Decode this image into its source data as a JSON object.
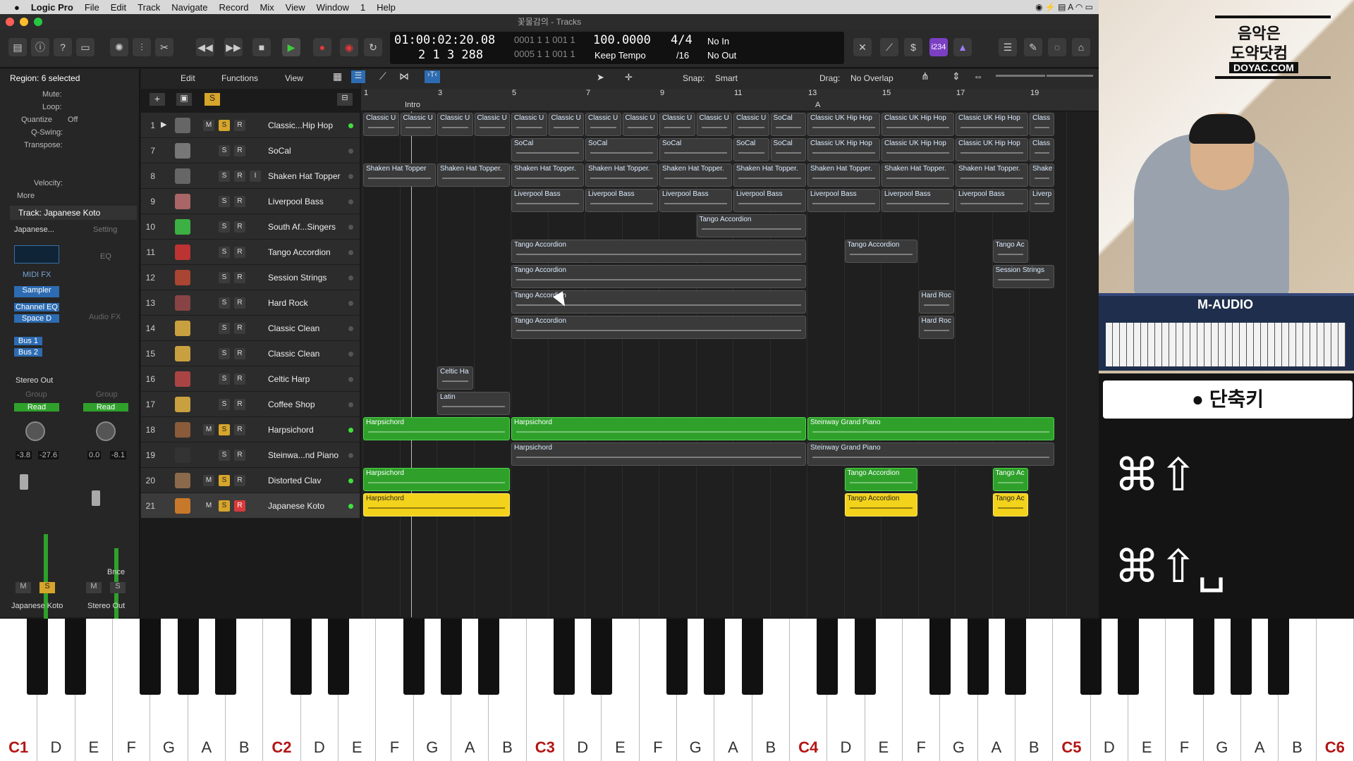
{
  "menu": {
    "app": "Logic Pro",
    "items": [
      "File",
      "Edit",
      "Track",
      "Navigate",
      "Record",
      "Mix",
      "View",
      "Window",
      "1",
      "Help"
    ]
  },
  "window_title": "꽃물감의 - Tracks",
  "lcd": {
    "time": "01:00:02:20.08",
    "bars": "2 1 3 288",
    "pos1": "0001 1 1 001 1",
    "pos2": "0005 1 1 001 1",
    "tempo": "100.0000",
    "tempo_mode": "Keep Tempo",
    "sig": "4/4",
    "div": "/16",
    "in": "No In",
    "out": "No Out",
    "cpu": "i234"
  },
  "inspector": {
    "region_header": "Region: 6 selected",
    "mute": "Mute:",
    "loop": "Loop:",
    "quantize": "Quantize",
    "quant_val": "Off",
    "qswing": "Q-Swing:",
    "transpose": "Transpose:",
    "velocity": "Velocity:",
    "more": "More",
    "track_header": "Track: Japanese Koto",
    "plugin_name": "Japanese...",
    "setting": "Setting",
    "midi_fx": "MIDI FX",
    "eq": "EQ",
    "sampler": "Sampler",
    "channel_eq": "Channel EQ",
    "space_d": "Space D",
    "audio_fx": "Audio FX",
    "bus1": "Bus 1",
    "bus2": "Bus 2",
    "stereo_out": "Stereo Out",
    "group": "Group",
    "read": "Read",
    "vol_a": "-3.8",
    "vol_b": "-27.6",
    "vol_c": "0.0",
    "vol_d": "-8.1",
    "bnce": "Bnce",
    "m": "M",
    "s": "S",
    "ch1": "Japanese Koto",
    "ch2": "Stereo Out"
  },
  "arr_toolbar": {
    "edit": "Edit",
    "functions": "Functions",
    "view": "View",
    "snap_label": "Snap:",
    "snap": "Smart",
    "drag_label": "Drag:",
    "drag": "No Overlap"
  },
  "ruler": {
    "bars": [
      "1",
      "3",
      "5",
      "7",
      "9",
      "11",
      "13",
      "15",
      "17",
      "19"
    ],
    "markers": [
      "Intro",
      "A"
    ]
  },
  "tracks": [
    {
      "num": "1",
      "name": "Classic...Hip Hop",
      "m": true,
      "s": true,
      "icon": "drum-machine-icon",
      "led": "green"
    },
    {
      "num": "7",
      "name": "SoCal",
      "icon": "drum-kit-icon",
      "led": "gray"
    },
    {
      "num": "8",
      "name": "Shaken Hat Topper",
      "icon": "drum-machine-icon",
      "led": "gray",
      "i": true
    },
    {
      "num": "9",
      "name": "Liverpool Bass",
      "icon": "bass-guitar-icon",
      "led": "gray"
    },
    {
      "num": "10",
      "name": "South Af...Singers",
      "icon": "choir-icon",
      "led": "gray"
    },
    {
      "num": "11",
      "name": "Tango Accordion",
      "icon": "accordion-icon",
      "led": "gray"
    },
    {
      "num": "12",
      "name": "Session Strings",
      "icon": "strings-icon",
      "led": "gray"
    },
    {
      "num": "13",
      "name": "Hard Rock",
      "icon": "electric-guitar-icon",
      "led": "gray"
    },
    {
      "num": "14",
      "name": "Classic Clean",
      "icon": "guitar-icon",
      "led": "gray"
    },
    {
      "num": "15",
      "name": "Classic Clean",
      "icon": "guitar-icon",
      "led": "gray"
    },
    {
      "num": "16",
      "name": "Celtic Harp",
      "icon": "harp-icon",
      "led": "gray"
    },
    {
      "num": "17",
      "name": "Coffee Shop",
      "icon": "percussion-icon",
      "led": "gray"
    },
    {
      "num": "18",
      "name": "Harpsichord",
      "m": true,
      "s": true,
      "icon": "harpsichord-icon",
      "led": "green"
    },
    {
      "num": "19",
      "name": "Steinwa...nd Piano",
      "icon": "piano-icon",
      "led": "gray"
    },
    {
      "num": "20",
      "name": "Distorted Clav",
      "m": true,
      "s": true,
      "icon": "clav-icon",
      "led": "green"
    },
    {
      "num": "21",
      "name": "Japanese Koto",
      "m": true,
      "s": true,
      "r": true,
      "icon": "koto-icon",
      "led": "green"
    }
  ],
  "regions": [
    {
      "row": 0,
      "bars": [
        [
          1,
          2,
          "Classic U"
        ],
        [
          2,
          3,
          "Classic U"
        ],
        [
          3,
          4,
          "Classic U"
        ],
        [
          4,
          5,
          "Classic U"
        ],
        [
          5,
          6,
          "Classic U"
        ],
        [
          6,
          7,
          "Classic U"
        ],
        [
          7,
          8,
          "Classic U"
        ],
        [
          8,
          9,
          "Classic U"
        ],
        [
          9,
          10,
          "Classic U"
        ],
        [
          10,
          11,
          "Classic U"
        ],
        [
          11,
          12,
          "Classic U"
        ],
        [
          12,
          13,
          "SoCal"
        ],
        [
          13,
          15,
          "Classic UK Hip Hop"
        ],
        [
          15,
          17,
          "Classic UK Hip Hop"
        ],
        [
          17,
          19,
          "Classic UK Hip Hop"
        ],
        [
          19,
          19.7,
          "Class"
        ]
      ],
      "style": "dark"
    },
    {
      "row": 1,
      "bars": [
        [
          5,
          7,
          "SoCal"
        ],
        [
          7,
          9,
          "SoCal"
        ],
        [
          9,
          11,
          "SoCal"
        ],
        [
          11,
          12,
          "SoCal"
        ],
        [
          12,
          13,
          "SoCal"
        ],
        [
          13,
          15,
          "Classic UK Hip Hop"
        ],
        [
          15,
          17,
          "Classic UK Hip Hop"
        ],
        [
          17,
          19,
          "Classic UK Hip Hop"
        ],
        [
          19,
          19.7,
          "Class"
        ]
      ],
      "style": "dark"
    },
    {
      "row": 2,
      "bars": [
        [
          1,
          3,
          "Shaken Hat Topper"
        ],
        [
          3,
          5,
          "Shaken Hat Topper."
        ],
        [
          5,
          7,
          "Shaken Hat Topper."
        ],
        [
          7,
          9,
          "Shaken Hat Topper."
        ],
        [
          9,
          11,
          "Shaken Hat Topper."
        ],
        [
          11,
          13,
          "Shaken Hat Topper."
        ],
        [
          13,
          15,
          "Shaken Hat Topper."
        ],
        [
          15,
          17,
          "Shaken Hat Topper."
        ],
        [
          17,
          19,
          "Shaken Hat Topper."
        ],
        [
          19,
          19.7,
          "Shake"
        ]
      ],
      "style": "dark"
    },
    {
      "row": 3,
      "bars": [
        [
          5,
          7,
          "Liverpool Bass"
        ],
        [
          7,
          9,
          "Liverpool Bass"
        ],
        [
          9,
          11,
          "Liverpool Bass"
        ],
        [
          11,
          13,
          "Liverpool Bass"
        ],
        [
          13,
          15,
          "Liverpool Bass"
        ],
        [
          15,
          17,
          "Liverpool Bass"
        ],
        [
          17,
          19,
          "Liverpool Bass"
        ],
        [
          19,
          19.7,
          "Liverp"
        ]
      ],
      "style": "dark"
    },
    {
      "row": 4,
      "bars": [
        [
          10,
          13,
          "Tango Accordion"
        ]
      ],
      "style": "dark"
    },
    {
      "row": 5,
      "bars": [
        [
          5,
          13,
          "Tango Accordion"
        ],
        [
          14,
          16,
          "Tango Accordion"
        ],
        [
          18,
          19,
          "Tango Ac"
        ]
      ],
      "style": "dark"
    },
    {
      "row": 6,
      "bars": [
        [
          5,
          13,
          "Tango Accordion"
        ],
        [
          18,
          19.7,
          "Session Strings"
        ]
      ],
      "style": "dark"
    },
    {
      "row": 7,
      "bars": [
        [
          5,
          13,
          "Tango Accordion"
        ],
        [
          16,
          17,
          "Hard Roc"
        ]
      ],
      "style": "dark"
    },
    {
      "row": 8,
      "bars": [
        [
          5,
          13,
          "Tango Accordion"
        ],
        [
          16,
          17,
          "Hard Roc"
        ]
      ],
      "style": "dark"
    },
    {
      "row": 10,
      "bars": [
        [
          3,
          4,
          "Celtic Ha"
        ]
      ],
      "style": "dark"
    },
    {
      "row": 11,
      "bars": [
        [
          3,
          5,
          "Latin"
        ]
      ],
      "style": "dark"
    },
    {
      "row": 12,
      "bars": [
        [
          1,
          5,
          "Harpsichord"
        ],
        [
          5,
          13,
          "Harpsichord"
        ],
        [
          13,
          19.7,
          "Steinway Grand Piano"
        ]
      ],
      "style": "green"
    },
    {
      "row": 13,
      "bars": [
        [
          5,
          13,
          "Harpsichord"
        ],
        [
          13,
          19.7,
          "Steinway Grand Piano"
        ]
      ],
      "style": "dark"
    },
    {
      "row": 14,
      "bars": [
        [
          1,
          5,
          "Harpsichord"
        ],
        [
          14,
          16,
          "Tango Accordion"
        ],
        [
          18,
          19,
          "Tango Ac"
        ]
      ],
      "style": "green"
    },
    {
      "row": 15,
      "bars": [
        [
          1,
          5,
          "Harpsichord"
        ],
        [
          14,
          16,
          "Tango Accordion"
        ],
        [
          18,
          19,
          "Tango Ac"
        ]
      ],
      "style": "yellow"
    }
  ],
  "overlay": {
    "logo_line1": "음악은",
    "logo_line2": "도약닷컴",
    "logo_url": "DOYAC.COM",
    "keyboard_brand": "M-AUDIO",
    "shortcut_title": "단축키",
    "shortcut1": "⌘⇧",
    "shortcut2": "⌘⇧␣"
  },
  "piano_labels": [
    "C1",
    "D",
    "E",
    "F",
    "G",
    "A",
    "B",
    "C2",
    "D",
    "E",
    "F",
    "G",
    "A",
    "B",
    "C3",
    "D",
    "E",
    "F",
    "G",
    "A",
    "B",
    "C4",
    "D",
    "E",
    "F",
    "G",
    "A",
    "B",
    "C5",
    "D",
    "E",
    "F",
    "G",
    "A",
    "B",
    "C6"
  ]
}
